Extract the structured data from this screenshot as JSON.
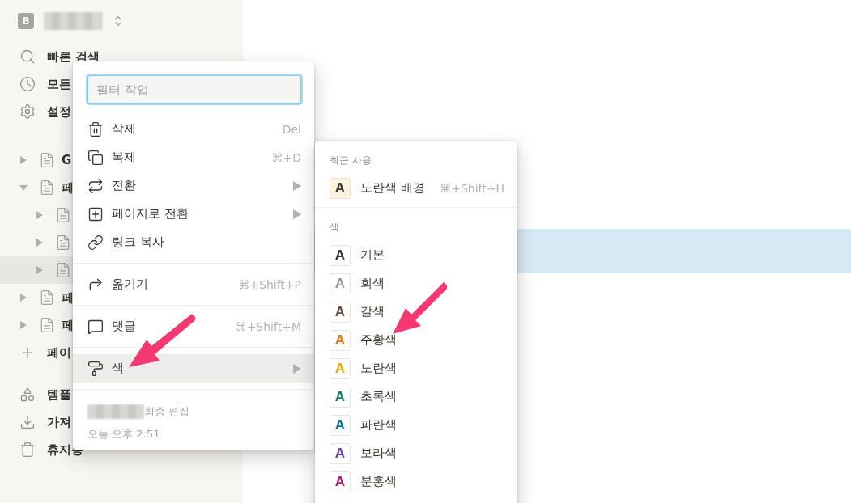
{
  "workspace": {
    "initial": "B"
  },
  "nav": [
    {
      "label": "빠른 검색"
    },
    {
      "label": "모든"
    },
    {
      "label": "설정"
    }
  ],
  "pages": [
    {
      "label": "G",
      "expanded": false,
      "selected": false
    },
    {
      "label": "페",
      "expanded": true,
      "selected": false,
      "children": [
        {
          "expanded": false,
          "selected": false
        },
        {
          "expanded": false,
          "selected": false
        },
        {
          "expanded": false,
          "selected": true
        }
      ]
    },
    {
      "label": "페",
      "expanded": false,
      "selected": false
    },
    {
      "label": "페",
      "expanded": false,
      "selected": false
    }
  ],
  "add_page": {
    "label": "페이"
  },
  "bottom_nav": [
    {
      "label": "템플"
    },
    {
      "label": "가져"
    },
    {
      "label": "휴지통"
    }
  ],
  "menu": {
    "filter": {
      "placeholder": "필터 작업"
    },
    "groups": [
      [
        {
          "label": "삭제",
          "shortcut": "Del",
          "submenu": false,
          "selected": false
        },
        {
          "label": "복제",
          "shortcut": "⌘+D",
          "submenu": false,
          "selected": false
        },
        {
          "label": "전환",
          "submenu": true,
          "selected": false
        },
        {
          "label": "페이지로 전환",
          "submenu": true,
          "selected": false
        },
        {
          "label": "링크 복사",
          "submenu": false,
          "selected": false
        }
      ],
      [
        {
          "label": "옮기기",
          "shortcut": "⌘+Shift+P",
          "submenu": false,
          "selected": false
        }
      ],
      [
        {
          "label": "댓글",
          "shortcut": "⌘+Shift+M",
          "submenu": false,
          "selected": false
        }
      ],
      [
        {
          "label": "색",
          "submenu": true,
          "selected": true
        }
      ]
    ],
    "footer": {
      "edited": "최종 편집",
      "time": "오늘 오후 2:51"
    }
  },
  "color_menu": {
    "sections": [
      {
        "title": "최근 사용",
        "items": [
          {
            "glyph": "A",
            "label": "노란색 배경",
            "shortcut": "⌘+Shift+H",
            "kind": "background",
            "color": "#fbf3db"
          }
        ]
      },
      {
        "title": "색",
        "items": [
          {
            "glyph": "A",
            "label": "기본",
            "kind": "text",
            "color": "#37352f"
          },
          {
            "glyph": "A",
            "label": "회색",
            "kind": "text",
            "color": "#9b9a97"
          },
          {
            "glyph": "A",
            "label": "갈색",
            "kind": "text",
            "color": "#64473a"
          },
          {
            "glyph": "A",
            "label": "주황색",
            "kind": "text",
            "color": "#d9730d"
          },
          {
            "glyph": "A",
            "label": "노란색",
            "kind": "text",
            "color": "#dfab01"
          },
          {
            "glyph": "A",
            "label": "초록색",
            "kind": "text",
            "color": "#0f7b6c"
          },
          {
            "glyph": "A",
            "label": "파란색",
            "kind": "text",
            "color": "#0b6e99"
          },
          {
            "glyph": "A",
            "label": "보라색",
            "kind": "text",
            "color": "#6940a5"
          },
          {
            "glyph": "A",
            "label": "분홍색",
            "kind": "text",
            "color": "#ad1a72"
          }
        ]
      }
    ]
  }
}
